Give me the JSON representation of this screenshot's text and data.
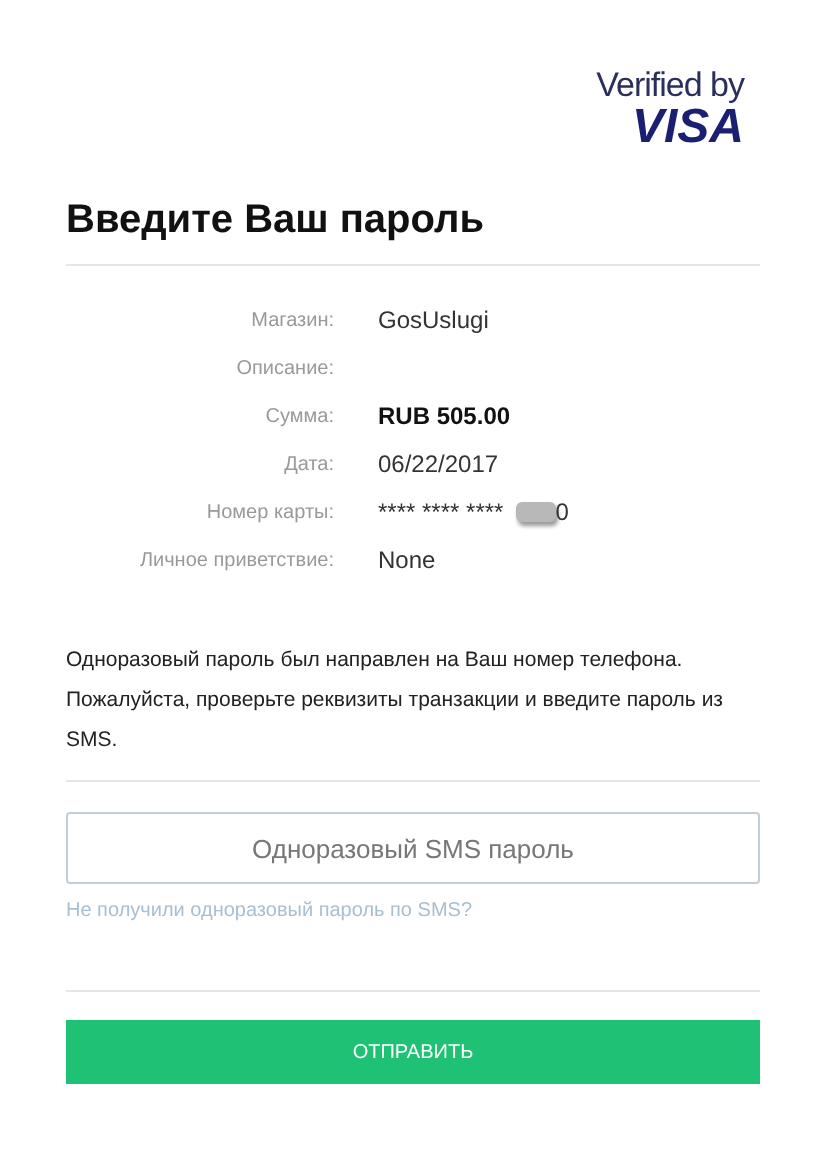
{
  "brand": {
    "line1": "Verified by",
    "line2": "VISA"
  },
  "title": "Введите Ваш пароль",
  "details": [
    {
      "label": "Магазин:",
      "value": "GosUslugi",
      "kind": "text"
    },
    {
      "label": "Описание:",
      "kind": "text"
    },
    {
      "label": "Сумма:",
      "value": "RUB 505.00",
      "kind": "bold"
    },
    {
      "label": "Дата:",
      "value": "06/22/2017",
      "kind": "text"
    },
    {
      "label": "Номер карты:",
      "value": "**** **** ****",
      "tail": "0",
      "kind": "card"
    },
    {
      "label": "Личное приветствие:",
      "value": "None",
      "kind": "text"
    }
  ],
  "message": "Одноразовый пароль был направлен на Ваш номер телефона. Пожалуйста, проверьте реквизиты транзакции и введите пароль из SMS.",
  "password_field": {
    "placeholder": "Одноразовый SMS пароль"
  },
  "resend_link": "Не получили одноразовый пароль по SMS?",
  "submit_button": "ОТПРАВИТЬ"
}
